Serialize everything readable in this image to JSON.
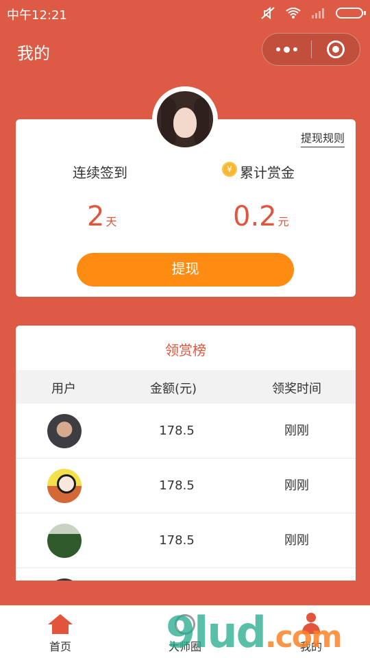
{
  "status_bar": {
    "time": "中午12:21"
  },
  "nav": {
    "title": "我的"
  },
  "profile": {
    "withdraw_rules": "提现规则",
    "streak_label": "连续签到",
    "streak_value": "2",
    "streak_unit": "天",
    "bonus_label": "累计赏金",
    "bonus_value": "0.2",
    "bonus_unit": "元",
    "coin_symbol": "¥",
    "withdraw_button": "提现"
  },
  "ranking": {
    "title": "领赏榜",
    "columns": [
      "用户",
      "金额(元)",
      "领奖时间"
    ],
    "rows": [
      {
        "amount": "178.5",
        "time": "刚刚"
      },
      {
        "amount": "178.5",
        "time": "刚刚"
      },
      {
        "amount": "178.5",
        "time": "刚刚"
      }
    ]
  },
  "tabbar": {
    "items": [
      {
        "label": "首页"
      },
      {
        "label": "大师圈"
      },
      {
        "label": "我的"
      }
    ]
  },
  "watermark": {
    "text": "9lud",
    "suffix": ".com"
  },
  "colors": {
    "brand": "#dd5a44",
    "accent_text": "#e2543b",
    "button": "#fe8b12"
  }
}
